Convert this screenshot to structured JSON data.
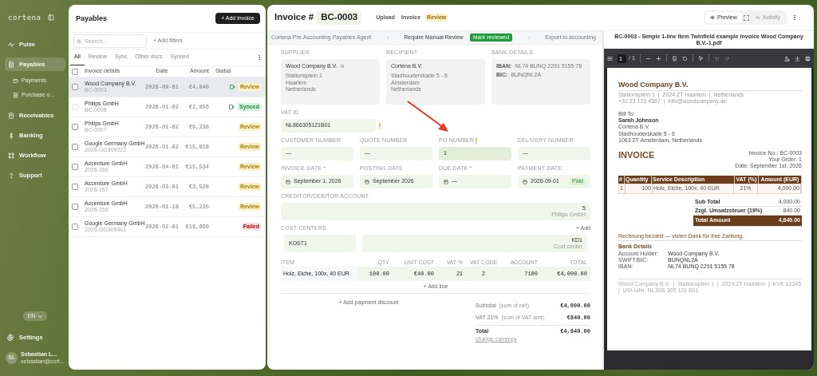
{
  "sidebar": {
    "logo": "cortena",
    "nav": [
      {
        "label": "Pulse",
        "selected": false
      },
      {
        "label": "Payables",
        "selected": true,
        "children": [
          {
            "label": "Payments",
            "selected": false
          },
          {
            "label": "Purchase o...",
            "selected": false
          }
        ]
      },
      {
        "label": "Receivables",
        "selected": false
      },
      {
        "label": "Banking",
        "selected": false
      },
      {
        "label": "Workflow",
        "selected": false
      },
      {
        "label": "Support",
        "selected": false
      }
    ],
    "language": "EN",
    "settings": "Settings",
    "user": {
      "initials": "SL",
      "name": "Sebastian L...",
      "email": "sebastian@cort..."
    }
  },
  "payables": {
    "title": "Payables",
    "add_button": "+ Add invoice",
    "search": {
      "placeholder": "Search..."
    },
    "add_filters": "+ Add filters",
    "tabs": [
      {
        "label": "All",
        "selected": true
      },
      {
        "label": "Review",
        "selected": false
      },
      {
        "label": "Sync",
        "selected": false
      },
      {
        "label": "Other docs",
        "selected": false
      },
      {
        "label": "Synced",
        "selected": false
      }
    ],
    "select_all": {
      "checked": false
    },
    "columns": [
      "Invoice details",
      "Date",
      "Amount",
      "Status"
    ],
    "rows": [
      {
        "vendor": "Wood Company B.V.",
        "number": "BC-0003",
        "date": "2026-09-01",
        "amount": "€4,840",
        "status": "Review",
        "color": "#fdf0c8",
        "export_icon": true,
        "selected": true,
        "checked": false,
        "disabled": false
      },
      {
        "vendor": "Philips GmbH",
        "number": "BC-0008",
        "date": "2026-01-02",
        "amount": "€2,856",
        "status": "Synced",
        "color": "#d3f4da",
        "export_icon": true,
        "selected": false,
        "checked": false,
        "disabled": true
      },
      {
        "vendor": "Philips GmbH",
        "number": "BC-0007",
        "date": "2026-01-02",
        "amount": "€9,238",
        "status": "Review",
        "color": "#fdf0c8",
        "export_icon": false,
        "selected": false,
        "checked": false,
        "disabled": false
      },
      {
        "vendor": "Google Germany GmbH",
        "number": "2026-GG309222",
        "date": "2026-01-02",
        "amount": "€15,918",
        "status": "Review",
        "color": "#fdf0c8",
        "export_icon": false,
        "selected": false,
        "checked": false,
        "disabled": false
      },
      {
        "vendor": "Accenture GmbH",
        "number": "2026-160",
        "date": "2026-04-01",
        "amount": "€15,534",
        "status": "Review",
        "color": "#fdf0c8",
        "export_icon": false,
        "selected": false,
        "checked": false,
        "disabled": false
      },
      {
        "vendor": "Accenture GmbH",
        "number": "2026-157",
        "date": "2026-03-01",
        "amount": "€3,528",
        "status": "Review",
        "color": "#fdf0c8",
        "export_icon": false,
        "selected": false,
        "checked": false,
        "disabled": false
      },
      {
        "vendor": "Accenture GmbH",
        "number": "2026-155",
        "date": "2026-01-18",
        "amount": "€5,235",
        "status": "Review",
        "color": "#fdf0c8",
        "export_icon": false,
        "selected": false,
        "checked": false,
        "disabled": false
      },
      {
        "vendor": "Google Germany GmbH",
        "number": "2026-GG309441",
        "date": "2026-02-01",
        "amount": "€16,660",
        "status": "Failed",
        "color": "#fde1e1",
        "export_icon": false,
        "selected": false,
        "checked": false,
        "disabled": false
      }
    ]
  },
  "invoice": {
    "label": "Invoice #",
    "number": "BC-0003",
    "stages": [
      {
        "label": "Upload",
        "selected": false
      },
      {
        "label": "Invoice",
        "selected": false
      },
      {
        "label": "Review",
        "selected": true
      }
    ],
    "view_tabs": [
      {
        "label": "Preview",
        "selected": true
      },
      {
        "label": "Activity",
        "selected": false
      }
    ],
    "workflow": [
      {
        "label": "Cortena Pre-Accounting Payables Agent",
        "current": false
      },
      {
        "label": "Require Manual Review",
        "current": true,
        "action": "Mark reviewed"
      },
      {
        "label": "Export to accounting",
        "current": false
      }
    ],
    "parties": [
      {
        "label": "SUPPLIER",
        "name": "Wood Company B.V.",
        "searchable": true,
        "lines": [
          "Stationsplein 1",
          "Haarlem",
          "Netherlands"
        ]
      },
      {
        "label": "RECIPIENT",
        "name": "Cortena B.V.",
        "searchable": false,
        "lines": [
          "Stadhouderskade 5 - 6",
          "Amsterdam",
          "Netherlands"
        ]
      }
    ],
    "bank": {
      "label": "BANK DETAILS",
      "lines": [
        {
          "key": "IBAN:",
          "value": "NL74 BUNQ 2291 5155 78"
        },
        {
          "key": "BIC:",
          "value": "BUNQNL2A"
        }
      ]
    },
    "vat_id": {
      "label": "VAT ID",
      "value": "NL866305121B01",
      "warning": true
    },
    "references": [
      {
        "label": "CUSTOMER NUMBER",
        "value": "—",
        "warning": false,
        "highlighted": false
      },
      {
        "label": "QUOTE NUMBER",
        "value": "—",
        "warning": false,
        "highlighted": false
      },
      {
        "label": "PO NUMBER",
        "value": "1",
        "warning": true,
        "highlighted": true
      },
      {
        "label": "DELIVERY NUMBER",
        "value": "—",
        "warning": false,
        "highlighted": false
      }
    ],
    "dates": [
      {
        "label": "INVOICE DATE *",
        "value": "September 1, 2026"
      },
      {
        "label": "POSTING DATE",
        "value": "September 2026"
      },
      {
        "label": "DUE DATE *",
        "value": "—"
      },
      {
        "label": "PAYMENT DATE:",
        "value": "2026-09-01",
        "badge": "Paid"
      }
    ],
    "account": {
      "label": "CREDITOR/DEBITOR ACCOUNT",
      "number": "5",
      "name": "Philips GmbH"
    },
    "cost_centers": {
      "label": "COST CENTERS",
      "add": "+ Add",
      "code": "KOST1",
      "value": "KD1",
      "caption": "Cost center"
    },
    "items": {
      "columns": [
        "ITEM",
        "QTY",
        "UNIT COST",
        "VAT %",
        "VAT CODE",
        "ACCOUNT",
        "TOTAL"
      ],
      "rows": [
        [
          "Holz, Eiche, 100x, 40 EUR",
          "100.00",
          "€40.00",
          "21",
          "2",
          "7100",
          "€4,000.00"
        ]
      ],
      "add_line": "+ Add line"
    },
    "totals": {
      "add_discount": "+ Add payment discount",
      "lines": [
        {
          "label": "Subtotal",
          "note": "(sum of net)",
          "value": "€4,000.00"
        },
        {
          "label": "VAT 21%",
          "note": "(sum of VAT amt)",
          "value": "€840.00"
        }
      ],
      "total": {
        "label": "Total",
        "value": "€4,840.00",
        "link": "change currency"
      }
    }
  },
  "pdf": {
    "filename": "BC-0003 - Simple 1-line item Twinfield example invoice Wood Company B.V.-1.pdf",
    "page": "1",
    "page_count": "/ 1",
    "document": {
      "company": "Wood Company B.V.",
      "company_lines": [
        "Stationsplein 1  |  2024 ZT Haarlem  |  Netherlands",
        "+31 23 123 4567  |  info@woodcompany.de"
      ],
      "bill_to_label": "Bill To:",
      "bill_to": [
        "Sarah Johnson",
        "Cortena B.V.",
        "Stadhouderskade 5 - 6",
        "1063 ZT Amsterdam, Netherlands"
      ],
      "title": "INVOICE",
      "meta": [
        "Invoice No.: BC-0003",
        "Your Order: 1",
        "Date: September 1st, 2026"
      ],
      "table": {
        "columns": [
          "#",
          "Quantity",
          "Service Description",
          "VAT (%)",
          "Amount (EUR)"
        ],
        "rows": [
          [
            "1",
            "100",
            "Holz, Eiche, 100x, 40 EUR",
            "21%",
            "4,000.00"
          ]
        ]
      },
      "totals": [
        {
          "label": "Sub Total",
          "value": "4,000.00"
        },
        {
          "label": "Zzgl. Umsatzsteuer (19%)",
          "value": "840.00"
        }
      ],
      "total": {
        "label": "Total Amount",
        "value": "4,840.00"
      },
      "paid_note": "Rechnung bezahlt — vielen Dank für Ihre Zahlung.",
      "bank_title": "Bank Details",
      "bank": [
        {
          "key": "Account Holder:",
          "value": "Wood Company B.V."
        },
        {
          "key": "SWIFT/BIC:",
          "value": "BUNQNL2A"
        },
        {
          "key": "IBAN:",
          "value": "NL74 BUNQ 2291 5155 78"
        }
      ],
      "footer": "Wood Company B.V.  |  Stationsplein 1  |  2024 ZT Haarlem  |  KVK 12345  |  USt-IdNr. NL 866 305 121 B01"
    }
  }
}
